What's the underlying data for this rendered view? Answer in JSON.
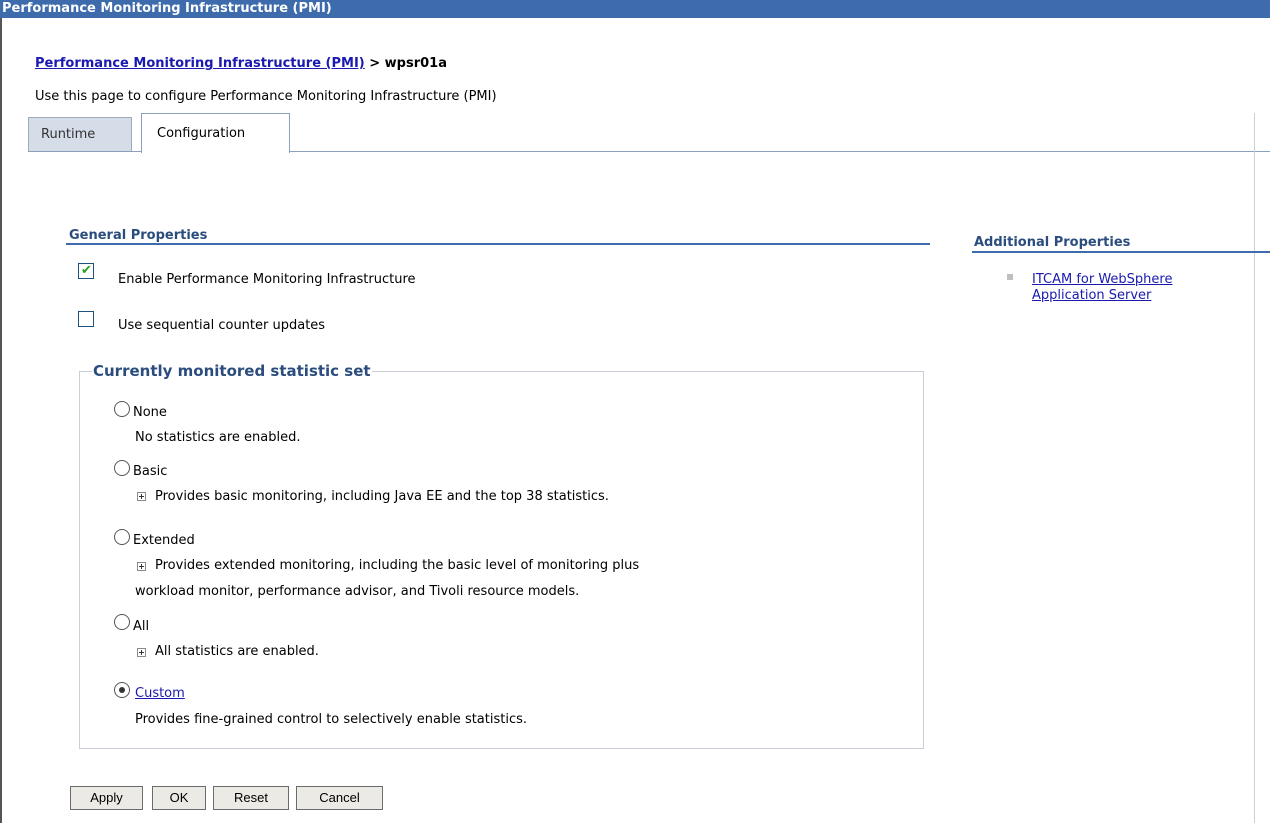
{
  "window": {
    "title": "Performance Monitoring Infrastructure (PMI)"
  },
  "breadcrumb": {
    "link": "Performance Monitoring Infrastructure (PMI)",
    "separator": " > ",
    "current": "wpsr01a"
  },
  "page": {
    "description": "Use this page to configure Performance Monitoring Infrastructure (PMI)"
  },
  "tabs": [
    {
      "label": "Runtime",
      "active": false
    },
    {
      "label": "Configuration",
      "active": true
    }
  ],
  "general_properties": {
    "title": "General Properties",
    "enable_pmi": {
      "label": "Enable Performance Monitoring Infrastructure",
      "checked": true
    },
    "sequential_updates": {
      "label": "Use sequential counter updates",
      "checked": false
    },
    "statistic_set": {
      "legend": "Currently monitored statistic set",
      "selected": "Custom",
      "options": [
        {
          "label": "None",
          "desc": "No statistics are enabled."
        },
        {
          "label": "Basic",
          "desc": "Provides basic monitoring, including Java EE and the top 38 statistics."
        },
        {
          "label": "Extended",
          "desc": "Provides extended monitoring, including the basic level of monitoring plus",
          "desc2": "workload monitor, performance advisor, and Tivoli resource models."
        },
        {
          "label": "All",
          "desc": "All statistics are enabled."
        },
        {
          "label": "Custom",
          "desc": "Provides fine-grained control to selectively enable statistics."
        }
      ]
    }
  },
  "additional_properties": {
    "title": "Additional Properties",
    "link": "ITCAM for WebSphere Application Server"
  },
  "buttons": {
    "apply": "Apply",
    "ok": "OK",
    "reset": "Reset",
    "cancel": "Cancel"
  },
  "colors": {
    "title_bar": "#3d6bab",
    "section_title": "#2b4d7e",
    "link": "#1a1ab0",
    "checkmark": "#21a121"
  }
}
